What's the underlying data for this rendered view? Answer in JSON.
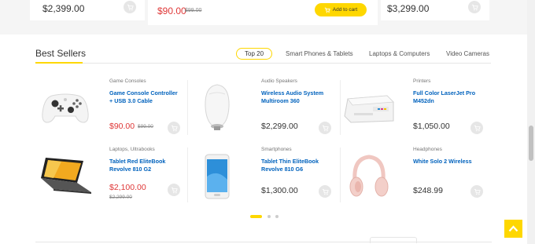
{
  "top_strip": {
    "cards": [
      {
        "price": "$2,399.00"
      },
      {
        "price": "$90.00",
        "old_price": "$99.00",
        "add_to_cart": "Add to cart"
      },
      {
        "price": "$3,299.00"
      }
    ]
  },
  "section": {
    "title": "Best Sellers",
    "tabs": [
      {
        "label": "Top 20",
        "active": true
      },
      {
        "label": "Smart Phones & Tablets",
        "active": false
      },
      {
        "label": "Laptops & Computers",
        "active": false
      },
      {
        "label": "Video Cameras",
        "active": false
      }
    ]
  },
  "products": [
    {
      "category": "Game Consoles",
      "name": "Game Console Controller + USB 3.0 Cable",
      "price": "$90.00",
      "old_price": "$99.00",
      "on_sale": true,
      "icon": "game-controller-icon"
    },
    {
      "category": "Audio Speakers",
      "name": "Wireless Audio System Multiroom 360",
      "price": "$2,299.00",
      "on_sale": false,
      "icon": "speaker-icon"
    },
    {
      "category": "Printers",
      "name": "Full Color LaserJet Pro M452dn",
      "price": "$1,050.00",
      "on_sale": false,
      "icon": "printer-icon"
    },
    {
      "category": "Laptops, Ultrabooks",
      "name": "Tablet Red EliteBook Revolve 810 G2",
      "price": "$2,100.00",
      "old_price": "$2,299.00",
      "on_sale": true,
      "icon": "laptop-icon"
    },
    {
      "category": "Smartphones",
      "name": "Tablet Thin EliteBook Revolve 810 G6",
      "price": "$1,300.00",
      "on_sale": false,
      "icon": "smartphone-icon"
    },
    {
      "category": "Headphones",
      "name": "White Solo 2 Wireless",
      "price": "$248.99",
      "on_sale": false,
      "icon": "headphones-icon"
    }
  ],
  "carousel": {
    "pages": 3,
    "active_index": 0
  },
  "colors": {
    "accent": "#fed700",
    "link": "#0062bd",
    "sale": "#df3737"
  }
}
